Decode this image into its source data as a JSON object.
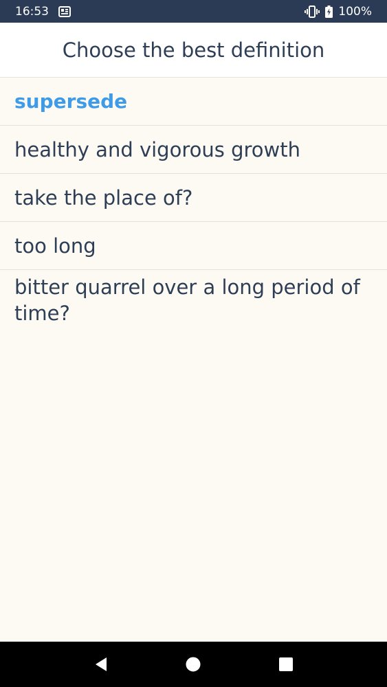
{
  "status_bar": {
    "time": "16:53",
    "battery": "100%",
    "icons": [
      "news-icon",
      "vibrate-icon",
      "battery-charging-icon"
    ]
  },
  "header": {
    "title": "Choose the best definition"
  },
  "quiz": {
    "word": "supersede",
    "options": [
      "healthy and vigorous growth",
      "take the place of?",
      "too long",
      "bitter quarrel over a long period of time?"
    ]
  },
  "nav_bar": {
    "icons": [
      "back-icon",
      "home-icon",
      "recents-icon"
    ]
  },
  "colors": {
    "status_bar": "#2b3a55",
    "accent": "#3e9be8",
    "text": "#2e3e55",
    "background": "#fcfaf3"
  }
}
